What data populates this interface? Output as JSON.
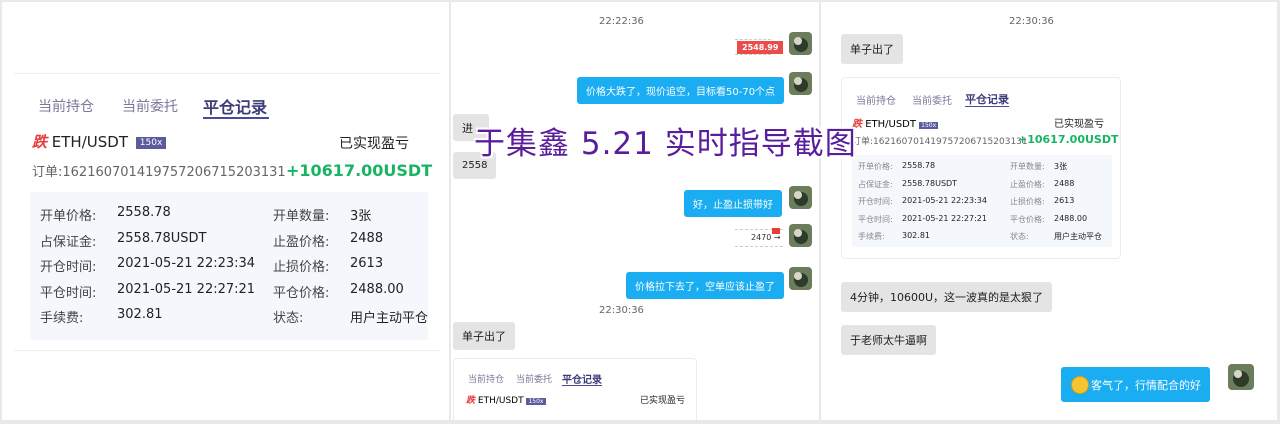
{
  "left_card": {
    "tabs": [
      "当前持仓",
      "当前委托",
      "平仓记录"
    ],
    "direction_badge": "跌",
    "pair": "ETH/USDT",
    "leverage": "150x",
    "pnl_label": "已实现盈亏",
    "order_no": "订单:16216070141975720671520313​1",
    "pnl_value": "+10617.00USDT",
    "details_left": [
      {
        "label": "开单价格:",
        "value": "2558.78"
      },
      {
        "label": "占保证金:",
        "value": "2558.78USDT"
      },
      {
        "label": "开仓时间:",
        "value": "2021-05-21 22:23:34"
      },
      {
        "label": "平仓时间:",
        "value": "2021-05-21 22:27:21"
      },
      {
        "label": "手续费:",
        "value": "302.81"
      }
    ],
    "details_right": [
      {
        "label": "开单数量:",
        "value": "3张"
      },
      {
        "label": "止盈价格:",
        "value": "2488"
      },
      {
        "label": "止损价格:",
        "value": "2613"
      },
      {
        "label": "平仓价格:",
        "value": "2488.00"
      },
      {
        "label": "状态:",
        "value": "用户主动平仓"
      }
    ]
  },
  "middle_chat": {
    "time1": "22:22:36",
    "chip_price": "2548.99",
    "msg1": "价格大跌了，现价追空，目标看50-70个点",
    "grey1": "进",
    "grey2": "2558",
    "msg2": "好，止盈止损带好",
    "arrow_price": "2470 →",
    "msg3": "价格拉下去了，空单应该止盈了",
    "time2": "22:30:36",
    "grey3": "单子出了",
    "mini_tabs": [
      "当前持仓",
      "当前委托",
      "平仓记录"
    ],
    "mini_badge": "跌",
    "mini_pair": "ETH/USDT",
    "mini_lev": "150x",
    "mini_pnl_label": "已实现盈亏"
  },
  "right_chat": {
    "time": "22:30:36",
    "grey1": "单子出了",
    "card": {
      "tabs": [
        "当前持仓",
        "当前委托",
        "平仓记录"
      ],
      "badge": "跌",
      "pair": "ETH/USDT",
      "lev": "150x",
      "pnl_label": "已实现盈亏",
      "order_no": "订单:16216070141975720671520313​1",
      "pnl_value": "+10617.00USDT",
      "details_left": [
        {
          "label": "开单价格:",
          "value": "2558.78"
        },
        {
          "label": "占保证金:",
          "value": "2558.78USDT"
        },
        {
          "label": "开仓时间:",
          "value": "2021-05-21 22:23:34"
        },
        {
          "label": "平仓时间:",
          "value": "2021-05-21 22:27:21"
        },
        {
          "label": "手续费:",
          "value": "302.81"
        }
      ],
      "details_right": [
        {
          "label": "开单数量:",
          "value": "3张"
        },
        {
          "label": "止盈价格:",
          "value": "2488"
        },
        {
          "label": "止损价格:",
          "value": "2613"
        },
        {
          "label": "平仓价格:",
          "value": "2488.00"
        },
        {
          "label": "状态:",
          "value": "用户主动平仓"
        }
      ]
    },
    "grey2": "4分钟，10600U，这一波真的是太狠了",
    "grey3": "于老师太牛逼啊",
    "blue1": "客气了，行情配合的好"
  },
  "watermark": "于集鑫 5.21 实时指导截图",
  "colors": {
    "accent_blue": "#1aadf2",
    "profit_green": "#19b463",
    "loss_red": "#e83c3c",
    "tab_active": "#3c3c78"
  }
}
